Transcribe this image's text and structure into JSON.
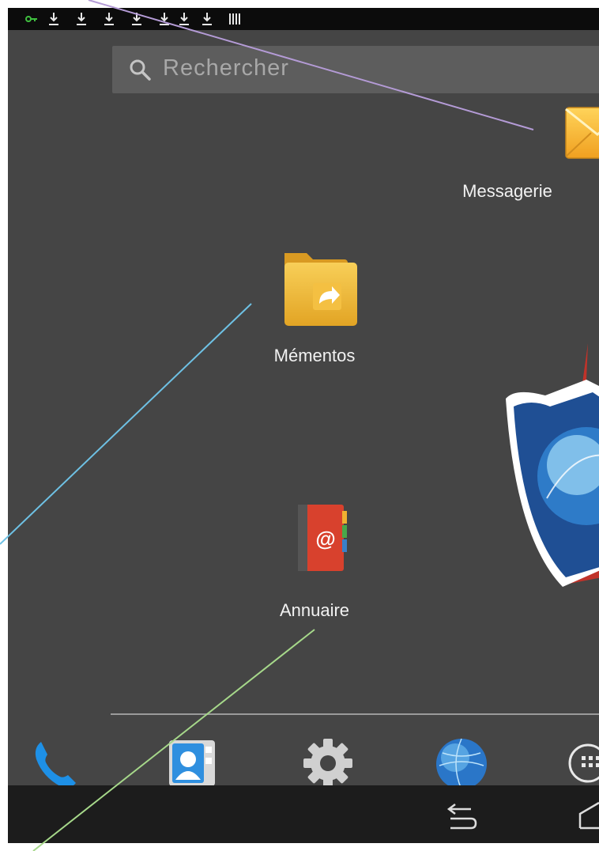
{
  "status_bar": {
    "icons": [
      "key-icon",
      "download-icon",
      "download-icon",
      "download-icon",
      "download-icon",
      "download-icon",
      "download-icon",
      "download-icon",
      "barcode-icon"
    ]
  },
  "search": {
    "placeholder": "Rechercher",
    "icon": "search-icon"
  },
  "apps": {
    "messagerie": {
      "label": "Messagerie",
      "icon": "envelope-icon"
    },
    "mementos": {
      "label": "Mémentos",
      "icon": "folder-shortcut-icon"
    },
    "annuaire": {
      "label": "Annuaire",
      "icon": "address-book-icon"
    }
  },
  "wallpaper": {
    "logo": "shield-globe-logo"
  },
  "dock": {
    "items": [
      {
        "name": "Téléphone",
        "icon": "phone-icon"
      },
      {
        "name": "Contacts",
        "icon": "contacts-icon"
      },
      {
        "name": "Paramètres",
        "icon": "gear-icon"
      },
      {
        "name": "Navigateur",
        "icon": "globe-icon"
      },
      {
        "name": "Applications",
        "icon": "app-drawer-icon"
      }
    ]
  },
  "nav_bar": {
    "buttons": [
      "back-icon",
      "home-icon"
    ]
  },
  "colors": {
    "screen_bg": "#454545",
    "status_bg": "#0c0c0c",
    "navbar_bg": "#1c1c1c",
    "callout_purple": "#b49bd6",
    "callout_blue": "#6ec1e4",
    "callout_green": "#a6d88a"
  }
}
